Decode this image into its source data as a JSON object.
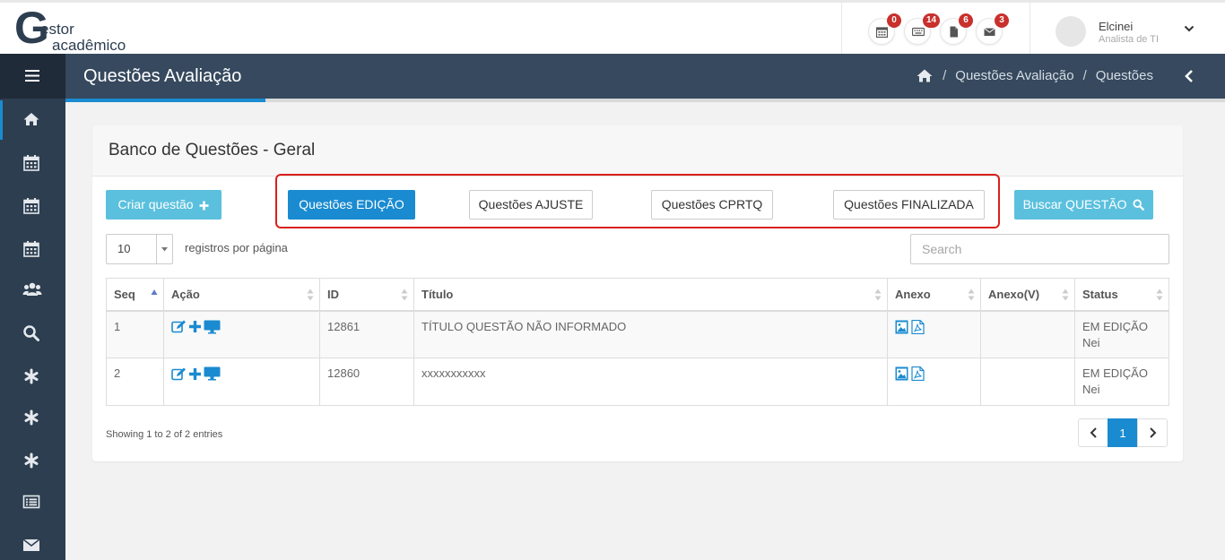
{
  "logo": {
    "letter": "G",
    "line1": "estor",
    "line2": "acadêmico"
  },
  "notifications": [
    {
      "icon": "calendar-icon",
      "count": "0"
    },
    {
      "icon": "keyboard-icon",
      "count": "14"
    },
    {
      "icon": "file-icon",
      "count": "6"
    },
    {
      "icon": "envelope-icon",
      "count": "3"
    }
  ],
  "user": {
    "name": "Elcinei",
    "role": "Analista de TI"
  },
  "sidebar": {
    "items": [
      "home-icon",
      "calendar-icon",
      "calendar-icon",
      "calendar-icon",
      "users-icon",
      "search-icon",
      "asterisk-icon",
      "asterisk-icon",
      "asterisk-icon",
      "list-icon",
      "envelope-icon"
    ]
  },
  "header": {
    "title": "Questões Avaliação",
    "breadcrumb": [
      "Questões Avaliação",
      "Questões"
    ],
    "breadcrumb_sep": "/"
  },
  "card": {
    "title": "Banco de Questões - Geral",
    "create_label": "Criar questão",
    "filters": [
      "Questões EDIÇÃO",
      "Questões AJUSTE",
      "Questões CPRTQ",
      "Questões FINALIZADA"
    ],
    "active_filter": "Questões EDIÇÃO",
    "search_button": "Buscar QUESTÃO"
  },
  "table_controls": {
    "page_length": "10",
    "page_length_label": "registros por página",
    "search_placeholder": "Search"
  },
  "table": {
    "columns": [
      "Seq",
      "Ação",
      "ID",
      "Título",
      "Anexo",
      "Anexo(V)",
      "Status"
    ],
    "rows": [
      {
        "seq": "1",
        "id": "12861",
        "titulo": "TÍTULO QUESTÃO NÃO INFORMADO",
        "anexo_v": "",
        "status": "EM EDIÇÃO",
        "status_user": "Nei"
      },
      {
        "seq": "2",
        "id": "12860",
        "titulo": "xxxxxxxxxxx",
        "anexo_v": "",
        "status": "EM EDIÇÃO",
        "status_user": "Nei"
      }
    ]
  },
  "footer": {
    "info": "Showing 1 to 2 of 2 entries",
    "current_page": "1"
  },
  "colors": {
    "primary": "#1a8bd0",
    "info": "#5bc0de",
    "sidebar": "#2c3e50",
    "header": "#36495e",
    "badge": "#c9302c",
    "highlight": "#d9201c"
  }
}
